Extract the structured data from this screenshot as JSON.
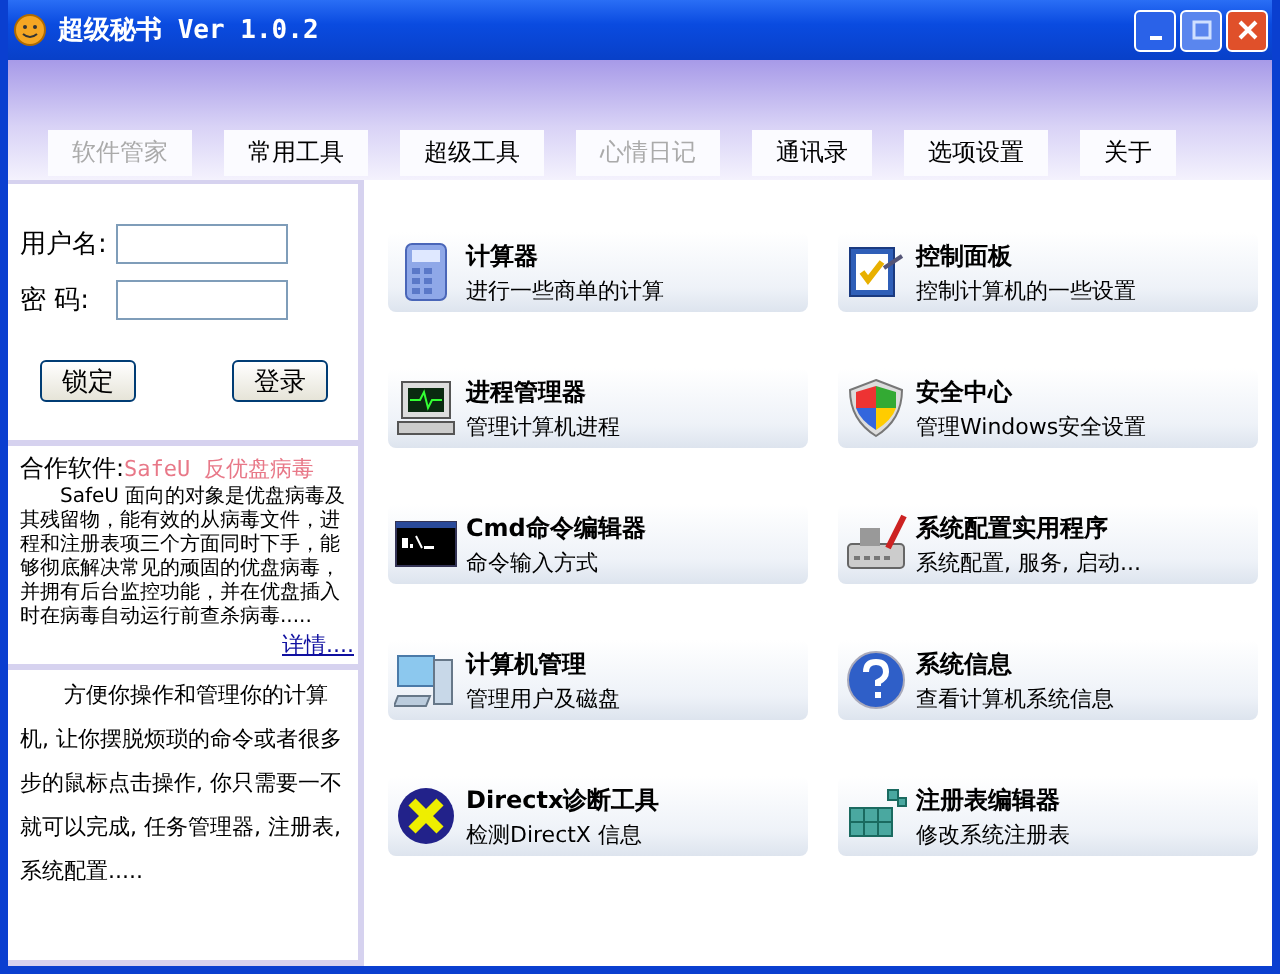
{
  "window": {
    "title": "超级秘书 Ver 1.0.2"
  },
  "tabs": [
    {
      "label": "软件管家",
      "disabled": true
    },
    {
      "label": "常用工具",
      "disabled": false
    },
    {
      "label": "超级工具",
      "disabled": false
    },
    {
      "label": "心情日记",
      "disabled": true
    },
    {
      "label": "通讯录",
      "disabled": false
    },
    {
      "label": "选项设置",
      "disabled": false
    },
    {
      "label": "关于",
      "disabled": false
    }
  ],
  "login": {
    "username_label": "用户名:",
    "password_label": "密 码:",
    "buttons": [
      "锁定",
      "登录"
    ]
  },
  "partner": {
    "label": "合作软件:",
    "name": "SafeU 反优盘病毒",
    "text": "SafeU 面向的对象是优盘病毒及其残留物，能有效的从病毒文件，进程和注册表项三个方面同时下手，能够彻底解决常见的顽固的优盘病毒，并拥有后台监控功能，并在优盘插入时在病毒自动运行前查杀病毒.....",
    "more": "详情...."
  },
  "description": "方便你操作和管理你的计算机, 让你摆脱烦琐的命令或者很多步的鼠标点击操作, 你只需要一不就可以完成, 任务管理器, 注册表, 系统配置.....",
  "tools": [
    {
      "kind": "calculator",
      "title": "计算器",
      "subtitle": "进行一些商单的计算"
    },
    {
      "kind": "control-panel",
      "title": "控制面板",
      "subtitle": "控制计算机的一些设置"
    },
    {
      "kind": "monitor",
      "title": "进程管理器",
      "subtitle": "管理计算机进程"
    },
    {
      "kind": "shield",
      "title": "安全中心",
      "subtitle": "管理Windows安全设置"
    },
    {
      "kind": "terminal",
      "title": "Cmd命令编辑器",
      "subtitle": "命令输入方式"
    },
    {
      "kind": "config",
      "title": "系统配置实用程序",
      "subtitle": "系统配置, 服务, 启动..."
    },
    {
      "kind": "computer",
      "title": "计算机管理",
      "subtitle": "管理用户及磁盘"
    },
    {
      "kind": "help",
      "title": "系统信息",
      "subtitle": "查看计算机系统信息"
    },
    {
      "kind": "directx",
      "title": "Directx诊断工具",
      "subtitle": "检测DirectX 信息"
    },
    {
      "kind": "registry",
      "title": "注册表编辑器",
      "subtitle": "修改系统注册表"
    }
  ]
}
